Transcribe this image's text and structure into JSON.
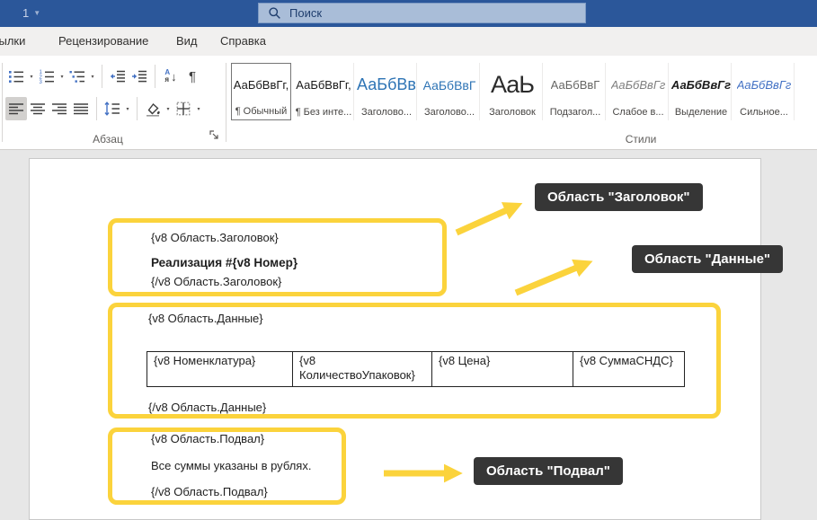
{
  "colors": {
    "titlebar_blue": "#2b579a",
    "search_box_blue": "#a9bdd8",
    "accent_yellow": "#fbd33c",
    "callout_bg": "#363636",
    "heading_style_blue": "#2e74b5",
    "strong_style_blue": "#4472c4"
  },
  "titlebar": {
    "doc_label": "1",
    "search_placeholder": "Поиск"
  },
  "ribbon_tabs": [
    "сылки",
    "Рецензирование",
    "Вид",
    "Справка"
  ],
  "ribbon": {
    "paragraph_group_label": "Абзац",
    "styles_group_label": "Стили",
    "icons": {
      "caret": "▾",
      "pilcrow": "¶",
      "sort_a": "А",
      "sort_b": "я",
      "sort_arrow": "↓"
    },
    "styles": [
      {
        "preview": "АаБбВвГг,",
        "label": "¶ Обычный"
      },
      {
        "preview": "АаБбВвГг,",
        "label": "¶ Без инте..."
      },
      {
        "preview": "АаБбВв",
        "label": "Заголово..."
      },
      {
        "preview": "АаБбВвГ",
        "label": "Заголово..."
      },
      {
        "preview": "АаЬ",
        "label": "Заголовок"
      },
      {
        "preview": "АаБбВвГ",
        "label": "Подзагол..."
      },
      {
        "preview": "АаБбВвГг",
        "label": "Слабое в..."
      },
      {
        "preview": "АаБбВвГг",
        "label": "Выделение"
      },
      {
        "preview": "АаБбВвГг",
        "label": "Сильное..."
      }
    ]
  },
  "document": {
    "header_region": {
      "open_tag": "{v8 Область.Заголовок}",
      "body": "Реализация #{v8 Номер}",
      "close_tag": "{/v8 Область.Заголовок}"
    },
    "data_region": {
      "open_tag": "{v8 Область.Данные}",
      "table_cells": [
        "{v8 Номенклатура}",
        "{v8 КоличествоУпаковок}",
        "{v8 Цена}",
        "{v8 СуммаСНДС}"
      ],
      "close_tag": "{/v8 Область.Данные}"
    },
    "footer_region": {
      "open_tag": "{v8 Область.Подвал}",
      "body": "Все суммы указаны в рублях.",
      "close_tag": "{/v8 Область.Подвал}"
    },
    "callouts": [
      "Область \"Заголовок\"",
      "Область \"Данные\"",
      "Область \"Подвал\""
    ]
  }
}
